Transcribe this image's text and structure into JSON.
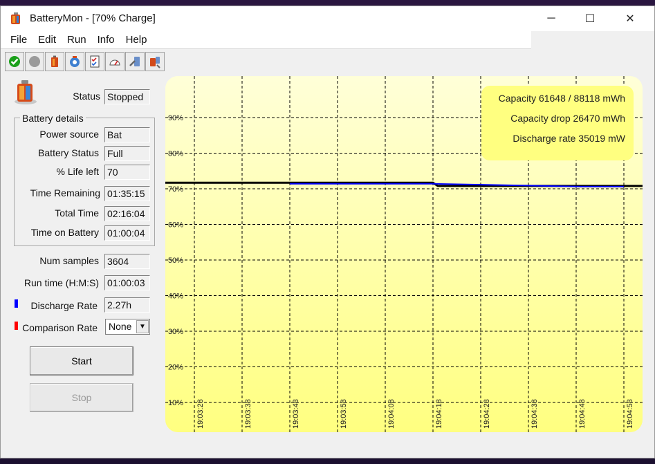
{
  "window": {
    "title": "BatteryMon - [70% Charge]",
    "controls": {
      "minimize": "─",
      "maximize": "☐",
      "close": "✕"
    }
  },
  "menu": [
    "File",
    "Edit",
    "Run",
    "Info",
    "Help"
  ],
  "toolbar": [
    {
      "icon": "start-check-icon"
    },
    {
      "icon": "stop-circle-icon"
    },
    {
      "icon": "battery-icon"
    },
    {
      "icon": "settings-battery-icon"
    },
    {
      "icon": "checklist-icon"
    },
    {
      "icon": "gauge-icon"
    },
    {
      "icon": "battery-tool-icon"
    },
    {
      "icon": "battery-info-icon"
    }
  ],
  "status": {
    "label": "Status",
    "value": "Stopped"
  },
  "battery_details": {
    "title": "Battery details",
    "rows": [
      {
        "label": "Power source",
        "value": "Bat"
      },
      {
        "label": "Battery Status",
        "value": "Full"
      },
      {
        "label": "% Life left",
        "value": "70"
      },
      {
        "label": "Time Remaining",
        "value": "01:35:15"
      },
      {
        "label": "Total Time",
        "value": "02:16:04"
      },
      {
        "label": "Time on Battery",
        "value": "01:00:04"
      }
    ]
  },
  "samples": {
    "label": "Num samples",
    "value": "3604"
  },
  "runtime": {
    "label": "Run time (H:M:S)",
    "value": "01:00:03"
  },
  "discharge": {
    "label": "Discharge Rate",
    "value": "2.27h",
    "color": "#0000ff"
  },
  "comparison": {
    "label": "Comparison Rate",
    "value": "None",
    "color": "#ff0000"
  },
  "buttons": {
    "start": "Start",
    "stop": "Stop"
  },
  "info": {
    "capacity": "Capacity 61648 / 88118 mWh",
    "drop": "Capacity drop 26470 mWh",
    "rate": "Discharge rate 35019 mW"
  },
  "colors": {
    "chart_bg_top": "#ffffd8",
    "chart_bg_bottom": "#ffff80",
    "charge_line": "#000000",
    "discharge_line": "#0000ff",
    "info_box": "#ffff80"
  },
  "chart_data": {
    "type": "line",
    "y_ticks": [
      "90%",
      "80%",
      "70%",
      "60%",
      "50%",
      "40%",
      "30%",
      "20%",
      "10%"
    ],
    "x_ticks": [
      "19:03:28",
      "19:03:38",
      "19:03:48",
      "19:03:58",
      "19:04:08",
      "19:04:18",
      "19:04:28",
      "19:04:38",
      "19:04:48",
      "19:04:58"
    ],
    "ylim": [
      5,
      95
    ],
    "grid": true,
    "series": [
      {
        "color": "#000000",
        "points": [
          [
            "19:03:28",
            71.7
          ],
          [
            "19:04:18",
            71.7
          ],
          [
            "19:04:19",
            70.8
          ],
          [
            "19:04:58",
            70.8
          ]
        ]
      },
      {
        "color": "#0000ff",
        "points": [
          [
            "19:03:48",
            71.4
          ],
          [
            "19:04:18",
            71.4
          ],
          [
            "19:04:49",
            70.6
          ],
          [
            "19:04:58",
            70.6
          ]
        ]
      }
    ]
  }
}
